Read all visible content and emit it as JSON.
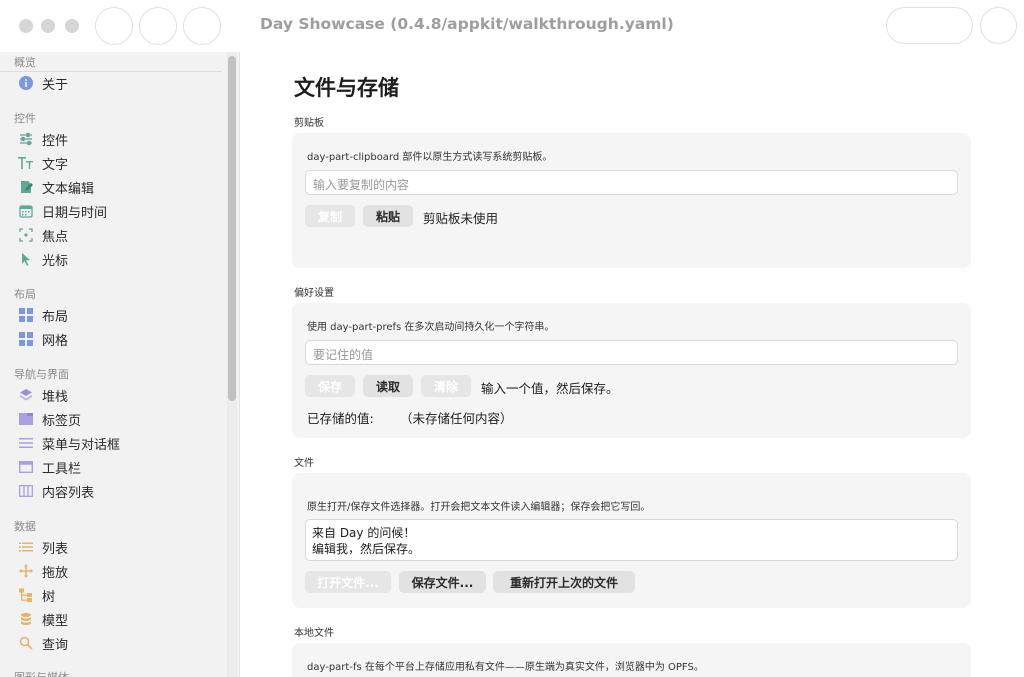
{
  "window": {
    "title": "Day Showcase (0.4.8/appkit/walkthrough.yaml)"
  },
  "sidebar": {
    "sections": [
      {
        "label": "概览",
        "items": [
          {
            "label": "关于",
            "icon": "info-icon"
          }
        ]
      },
      {
        "label": "控件",
        "items": [
          {
            "label": "控件",
            "icon": "sliders-icon"
          },
          {
            "label": "文字",
            "icon": "text-icon"
          },
          {
            "label": "文本编辑",
            "icon": "edit-doc-icon"
          },
          {
            "label": "日期与时间",
            "icon": "calendar-icon"
          },
          {
            "label": "焦点",
            "icon": "focus-icon"
          },
          {
            "label": "光标",
            "icon": "cursor-icon"
          }
        ]
      },
      {
        "label": "布局",
        "items": [
          {
            "label": "布局",
            "icon": "layout-grid-icon"
          },
          {
            "label": "网格",
            "icon": "grid-icon"
          }
        ]
      },
      {
        "label": "导航与界面",
        "items": [
          {
            "label": "堆栈",
            "icon": "stack-icon"
          },
          {
            "label": "标签页",
            "icon": "tabs-icon"
          },
          {
            "label": "菜单与对话框",
            "icon": "menu-icon"
          },
          {
            "label": "工具栏",
            "icon": "toolbar-icon"
          },
          {
            "label": "内容列表",
            "icon": "columns-icon"
          }
        ]
      },
      {
        "label": "数据",
        "items": [
          {
            "label": "列表",
            "icon": "list-icon"
          },
          {
            "label": "拖放",
            "icon": "move-icon"
          },
          {
            "label": "树",
            "icon": "tree-icon"
          },
          {
            "label": "模型",
            "icon": "database-icon"
          },
          {
            "label": "查询",
            "icon": "search-icon"
          }
        ]
      },
      {
        "label": "图形与媒体",
        "items": []
      }
    ]
  },
  "main": {
    "title": "文件与存储",
    "clipboard": {
      "section": "剪贴板",
      "desc": "day-part-clipboard 部件以原生方式读写系统剪贴板。",
      "placeholder": "输入要复制的内容",
      "copy_label": "复制",
      "paste_label": "粘贴",
      "status": "剪贴板未使用"
    },
    "prefs": {
      "section": "偏好设置",
      "desc": "使用 day-part-prefs 在多次启动间持久化一个字符串。",
      "placeholder": "要记住的值",
      "save_label": "保存",
      "load_label": "读取",
      "clear_label": "清除",
      "status": "输入一个值，然后保存。",
      "stored_label": "已存储的值:",
      "stored_value": "（未存储任何内容）"
    },
    "files": {
      "section": "文件",
      "desc": "原生打开/保存文件选择器。打开会把文本文件读入编辑器；保存会把它写回。",
      "text_line1": "来自 Day 的问候！",
      "text_line2": "编辑我，然后保存。",
      "open_label": "打开文件...",
      "save_label": "保存文件...",
      "reopen_label": "重新打开上次的文件"
    },
    "localfs": {
      "section": "本地文件",
      "desc": "day-part-fs 在每个平台上存储应用私有文件——原生端为真实文件，浏览器中为 OPFS。"
    }
  },
  "colors": {
    "sidebar_bg": "#f2f2f2",
    "card_bg": "#f5f5f5",
    "accent_blue": "#7b97e0",
    "accent_green": "#5fa89a",
    "accent_purple": "#a8a0e0",
    "accent_orange": "#e8b26a"
  }
}
